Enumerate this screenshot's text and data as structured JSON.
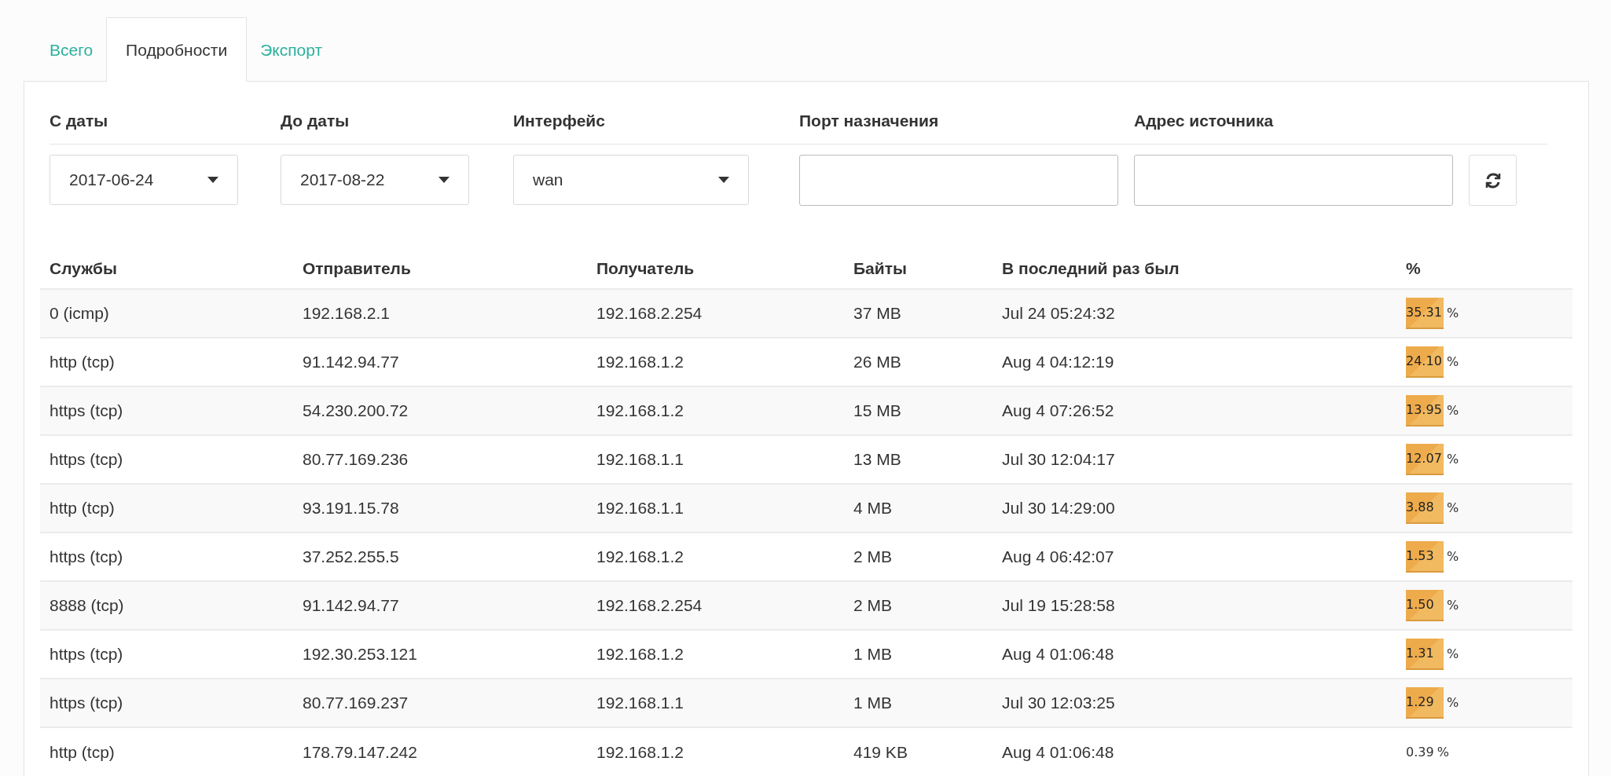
{
  "tabs": [
    {
      "label": "Всего",
      "selected": false
    },
    {
      "label": "Подробности",
      "selected": true
    },
    {
      "label": "Экспорт",
      "selected": false
    }
  ],
  "filters": [
    {
      "label": "С даты",
      "kind": "select",
      "value": "2017-06-24"
    },
    {
      "label": "До даты",
      "kind": "select",
      "value": "2017-08-22"
    },
    {
      "label": "Интерфейс",
      "kind": "select",
      "value": "wan"
    },
    {
      "label": "Порт назначения",
      "kind": "text"
    },
    {
      "label": "Адрес источника",
      "kind": "text"
    }
  ],
  "table": {
    "columns": [
      "Службы",
      "Отправитель",
      "Получатель",
      "Байты",
      "В последний раз был",
      "%"
    ],
    "rows": [
      {
        "service": "0 (icmp)",
        "source": "192.168.2.1",
        "destination": "192.168.2.254",
        "bytes": "37 MB",
        "last_seen": "Jul 24 05:24:32",
        "percent": "35.31",
        "unit": "%",
        "bar": true
      },
      {
        "service": "http (tcp)",
        "source": "91.142.94.77",
        "destination": "192.168.1.2",
        "bytes": "26 MB",
        "last_seen": "Aug 4 04:12:19",
        "percent": "24.10",
        "unit": "%",
        "bar": true
      },
      {
        "service": "https (tcp)",
        "source": "54.230.200.72",
        "destination": "192.168.1.2",
        "bytes": "15 MB",
        "last_seen": "Aug 4 07:26:52",
        "percent": "13.95",
        "unit": "%",
        "bar": true
      },
      {
        "service": "https (tcp)",
        "source": "80.77.169.236",
        "destination": "192.168.1.1",
        "bytes": "13 MB",
        "last_seen": "Jul 30 12:04:17",
        "percent": "12.07",
        "unit": "%",
        "bar": true
      },
      {
        "service": "http (tcp)",
        "source": "93.191.15.78",
        "destination": "192.168.1.1",
        "bytes": "4 MB",
        "last_seen": "Jul 30 14:29:00",
        "percent": "3.88",
        "unit": "%",
        "bar": true
      },
      {
        "service": "https (tcp)",
        "source": "37.252.255.5",
        "destination": "192.168.1.2",
        "bytes": "2 MB",
        "last_seen": "Aug 4 06:42:07",
        "percent": "1.53",
        "unit": "%",
        "bar": true
      },
      {
        "service": "8888 (tcp)",
        "source": "91.142.94.77",
        "destination": "192.168.2.254",
        "bytes": "2 MB",
        "last_seen": "Jul 19 15:28:58",
        "percent": "1.50",
        "unit": "%",
        "bar": true
      },
      {
        "service": "https (tcp)",
        "source": "192.30.253.121",
        "destination": "192.168.1.2",
        "bytes": "1 MB",
        "last_seen": "Aug 4 01:06:48",
        "percent": "1.31",
        "unit": "%",
        "bar": true
      },
      {
        "service": "https (tcp)",
        "source": "80.77.169.237",
        "destination": "192.168.1.1",
        "bytes": "1 MB",
        "last_seen": "Jul 30 12:03:25",
        "percent": "1.29",
        "unit": "%",
        "bar": true
      },
      {
        "service": "http (tcp)",
        "source": "178.79.147.242",
        "destination": "192.168.1.2",
        "bytes": "419 KB",
        "last_seen": "Aug 4 01:06:48",
        "percent": "0.39",
        "unit": "%",
        "bar": false
      }
    ]
  }
}
